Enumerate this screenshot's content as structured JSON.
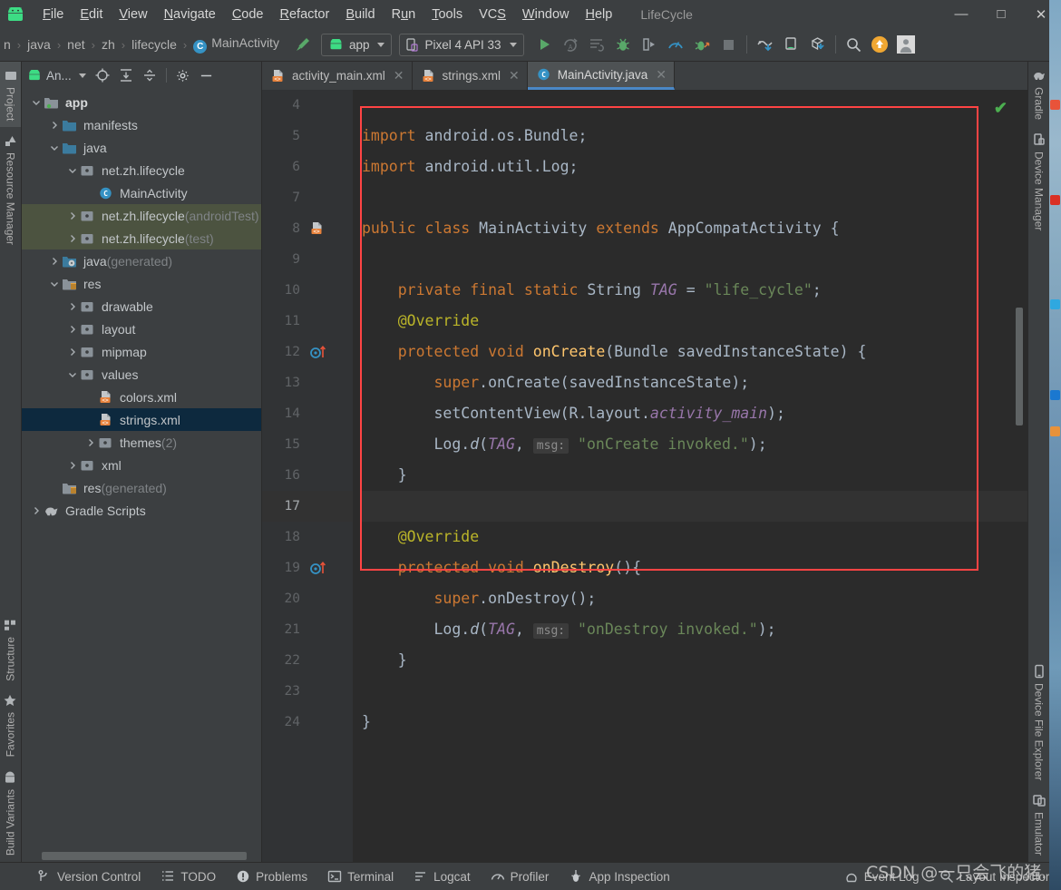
{
  "window": {
    "title": "LifeCycle",
    "minimize": "—",
    "maximize": "□",
    "close": "✕"
  },
  "menubar": {
    "logo_icon": "android-logo-icon",
    "items": [
      {
        "label": "File",
        "mnemonic": "F"
      },
      {
        "label": "Edit",
        "mnemonic": "E"
      },
      {
        "label": "View",
        "mnemonic": "V"
      },
      {
        "label": "Navigate",
        "mnemonic": "N"
      },
      {
        "label": "Code",
        "mnemonic": "C"
      },
      {
        "label": "Refactor",
        "mnemonic": "R"
      },
      {
        "label": "Build",
        "mnemonic": "B"
      },
      {
        "label": "Run",
        "mnemonic": "u"
      },
      {
        "label": "Tools",
        "mnemonic": "T"
      },
      {
        "label": "VCS",
        "mnemonic": "S"
      },
      {
        "label": "Window",
        "mnemonic": "W"
      },
      {
        "label": "Help",
        "mnemonic": "H"
      }
    ]
  },
  "toolbar": {
    "breadcrumb": [
      {
        "label": "n",
        "truncated": true
      },
      {
        "label": "java"
      },
      {
        "label": "net"
      },
      {
        "label": "zh"
      },
      {
        "label": "lifecycle"
      },
      {
        "label": "MainActivity",
        "icon": "class-icon",
        "badge": "C"
      }
    ],
    "separator": "›",
    "make_project_icon": "hammer-icon",
    "module_selector": {
      "label": "app",
      "icon": "android-module-icon"
    },
    "device_selector": {
      "label": "Pixel 4 API 33",
      "icon": "device-icon"
    },
    "actions": [
      {
        "name": "run-button",
        "icon": "play-icon",
        "color": "#59a869"
      },
      {
        "name": "apply-changes-button",
        "icon": "apply-changes-icon",
        "color": "#6e7376"
      },
      {
        "name": "apply-code-changes-button",
        "icon": "apply-code-changes-icon",
        "color": "#6e7376"
      },
      {
        "name": "debug-button",
        "icon": "bug-icon",
        "color": "#59a869"
      },
      {
        "name": "attach-debugger-button",
        "icon": "attach-debugger-icon",
        "color": "#9aa0a6"
      },
      {
        "name": "profiler-button",
        "icon": "profiler-icon",
        "color": "#3592c4"
      },
      {
        "name": "run-with-coverage-button",
        "icon": "coverage-icon",
        "color": "#59a869"
      },
      {
        "name": "stop-button",
        "icon": "stop-icon",
        "color": "#6e7376"
      },
      {
        "name": "sdk-manager-button",
        "icon": "sdk-manager-icon",
        "color": "#9aa0a6"
      },
      {
        "name": "avd-manager-button",
        "icon": "avd-manager-icon",
        "color": "#9aa0a6"
      },
      {
        "name": "device-file-button",
        "icon": "device-download-icon",
        "color": "#9aa0a6"
      },
      {
        "name": "search-button",
        "icon": "search-icon",
        "color": "#c0c0c0"
      },
      {
        "name": "update-button",
        "icon": "update-arrow-icon",
        "color": "#f0a732"
      },
      {
        "name": "account-button",
        "icon": "avatar-icon",
        "color": "#d8d8d8"
      }
    ]
  },
  "left_rail": {
    "top": [
      {
        "label": "Project",
        "icon": "project-icon",
        "active": true
      },
      {
        "label": "Resource Manager",
        "icon": "resource-manager-icon",
        "active": false
      }
    ],
    "bottom": [
      {
        "label": "Structure",
        "icon": "structure-icon"
      },
      {
        "label": "Favorites",
        "icon": "star-icon"
      },
      {
        "label": "Build Variants",
        "icon": "build-variants-icon"
      }
    ]
  },
  "right_rail": {
    "top": [
      {
        "label": "Gradle",
        "icon": "gradle-elephant-icon"
      },
      {
        "label": "Device Manager",
        "icon": "device-manager-icon"
      }
    ],
    "bottom": [
      {
        "label": "Device File Explorer",
        "icon": "device-file-explorer-icon"
      },
      {
        "label": "Emulator",
        "icon": "emulator-icon"
      }
    ]
  },
  "project_panel": {
    "title": "An...",
    "title_icon": "android-view-icon",
    "buttons": [
      {
        "name": "select-opened-file-button",
        "icon": "target-icon"
      },
      {
        "name": "expand-all-button",
        "icon": "expand-all-icon"
      },
      {
        "name": "collapse-all-button",
        "icon": "collapse-all-icon"
      },
      {
        "name": "settings-button",
        "icon": "gear-icon"
      },
      {
        "name": "hide-button",
        "icon": "minus-icon"
      }
    ],
    "tree": [
      {
        "label": "app",
        "suffix": "",
        "depth": 0,
        "arrow": "down",
        "icon": "module-icon",
        "bold": true,
        "state": "normal"
      },
      {
        "label": "manifests",
        "suffix": "",
        "depth": 1,
        "arrow": "right",
        "icon": "folder-blue-icon",
        "state": "normal"
      },
      {
        "label": "java",
        "suffix": "",
        "depth": 1,
        "arrow": "down",
        "icon": "folder-blue-icon",
        "state": "normal"
      },
      {
        "label": "net.zh.lifecycle",
        "suffix": "",
        "depth": 2,
        "arrow": "down",
        "icon": "package-icon",
        "state": "normal"
      },
      {
        "label": "MainActivity",
        "suffix": "",
        "depth": 3,
        "arrow": "none",
        "icon": "class-icon",
        "state": "normal"
      },
      {
        "label": "net.zh.lifecycle",
        "suffix": " (androidTest)",
        "depth": 2,
        "arrow": "right",
        "icon": "package-icon",
        "state": "green"
      },
      {
        "label": "net.zh.lifecycle",
        "suffix": " (test)",
        "depth": 2,
        "arrow": "right",
        "icon": "package-icon",
        "state": "green"
      },
      {
        "label": "java",
        "suffix": " (generated)",
        "depth": 1,
        "arrow": "right",
        "icon": "folder-generated-icon",
        "state": "normal"
      },
      {
        "label": "res",
        "suffix": "",
        "depth": 1,
        "arrow": "down",
        "icon": "folder-res-icon",
        "state": "normal"
      },
      {
        "label": "drawable",
        "suffix": "",
        "depth": 2,
        "arrow": "right",
        "icon": "package-icon",
        "state": "normal"
      },
      {
        "label": "layout",
        "suffix": "",
        "depth": 2,
        "arrow": "right",
        "icon": "package-icon",
        "state": "normal"
      },
      {
        "label": "mipmap",
        "suffix": "",
        "depth": 2,
        "arrow": "right",
        "icon": "package-icon",
        "state": "normal"
      },
      {
        "label": "values",
        "suffix": "",
        "depth": 2,
        "arrow": "down",
        "icon": "package-icon",
        "state": "normal"
      },
      {
        "label": "colors.xml",
        "suffix": "",
        "depth": 3,
        "arrow": "none",
        "icon": "xml-file-icon",
        "state": "normal"
      },
      {
        "label": "strings.xml",
        "suffix": "",
        "depth": 3,
        "arrow": "none",
        "icon": "xml-file-icon",
        "state": "selected"
      },
      {
        "label": "themes",
        "suffix": " (2)",
        "depth": 3,
        "arrow": "right",
        "icon": "package-icon",
        "state": "normal"
      },
      {
        "label": "xml",
        "suffix": "",
        "depth": 2,
        "arrow": "right",
        "icon": "package-icon",
        "state": "normal"
      },
      {
        "label": "res",
        "suffix": " (generated)",
        "depth": 1,
        "arrow": "none",
        "icon": "folder-res-icon",
        "state": "normal"
      },
      {
        "label": "Gradle Scripts",
        "suffix": "",
        "depth": 0,
        "arrow": "right",
        "icon": "gradle-elephant-icon",
        "state": "normal"
      }
    ]
  },
  "editor": {
    "tabs": [
      {
        "label": "activity_main.xml",
        "icon": "xml-file-icon",
        "active": false,
        "close": "✕"
      },
      {
        "label": "strings.xml",
        "icon": "xml-file-icon",
        "active": false,
        "close": "✕"
      },
      {
        "label": "MainActivity.java",
        "icon": "class-icon",
        "active": true,
        "close": "✕"
      }
    ],
    "inspection_status_icon": "checkmark-ok-icon",
    "line_numbers": [
      "4",
      "5",
      "6",
      "7",
      "8",
      "9",
      "10",
      "11",
      "12",
      "13",
      "14",
      "15",
      "16",
      "17",
      "18",
      "19",
      "20",
      "21",
      "22",
      "23",
      "24"
    ],
    "gutter_markers": [
      {
        "line": "8",
        "icon": "xml-resource-gutter-icon"
      },
      {
        "line": "12",
        "icon": "override-method-icon"
      },
      {
        "line": "19",
        "icon": "override-method-icon"
      }
    ],
    "code_lines": [
      {
        "n": "4",
        "text": ""
      },
      {
        "n": "5",
        "text": "import android.os.Bundle;"
      },
      {
        "n": "6",
        "text": "import android.util.Log;"
      },
      {
        "n": "7",
        "text": ""
      },
      {
        "n": "8",
        "text": "public class MainActivity extends AppCompatActivity {"
      },
      {
        "n": "9",
        "text": ""
      },
      {
        "n": "10",
        "text": "    private final static String TAG = \"life_cycle\";"
      },
      {
        "n": "11",
        "text": "    @Override"
      },
      {
        "n": "12",
        "text": "    protected void onCreate(Bundle savedInstanceState) {"
      },
      {
        "n": "13",
        "text": "        super.onCreate(savedInstanceState);"
      },
      {
        "n": "14",
        "text": "        setContentView(R.layout.activity_main);"
      },
      {
        "n": "15",
        "text": "        Log.d(TAG, msg: \"onCreate invoked.\");"
      },
      {
        "n": "16",
        "text": "    }"
      },
      {
        "n": "17",
        "text": ""
      },
      {
        "n": "18",
        "text": "    @Override"
      },
      {
        "n": "19",
        "text": "    protected void onDestroy(){"
      },
      {
        "n": "20",
        "text": "        super.onDestroy();"
      },
      {
        "n": "21",
        "text": "        Log.d(TAG, msg: \"onDestroy invoked.\");"
      },
      {
        "n": "22",
        "text": "    }"
      },
      {
        "n": "23",
        "text": ""
      },
      {
        "n": "24",
        "text": "}"
      }
    ],
    "annotation_box_color": "#ff4444",
    "hint_label": "msg:"
  },
  "status_bar": {
    "items": [
      {
        "label": "Version Control",
        "icon": "branch-icon"
      },
      {
        "label": "TODO",
        "icon": "todo-list-icon"
      },
      {
        "label": "Problems",
        "icon": "problems-icon"
      },
      {
        "label": "Terminal",
        "icon": "terminal-icon"
      },
      {
        "label": "Logcat",
        "icon": "logcat-icon"
      },
      {
        "label": "Profiler",
        "icon": "profiler-icon"
      },
      {
        "label": "App Inspection",
        "icon": "app-inspection-icon"
      },
      {
        "label": "Event Log",
        "icon": "event-log-icon"
      },
      {
        "label": "Layout Inspector",
        "icon": "layout-inspector-icon"
      }
    ]
  },
  "watermark": {
    "text": "CSDN @一只会飞的猪."
  },
  "colors": {
    "accent_blue": "#4a88c7",
    "keyword_orange": "#cc7832",
    "string_green": "#6a8759",
    "annotation_yellow": "#bbb529",
    "method_yellow": "#ffc66d",
    "field_purple": "#9876aa",
    "panel_bg": "#3c3f41",
    "editor_bg": "#2b2b2b",
    "selection_blue": "#0d293e",
    "test_green": "#4c5340",
    "highlight_red": "#ff4444"
  }
}
